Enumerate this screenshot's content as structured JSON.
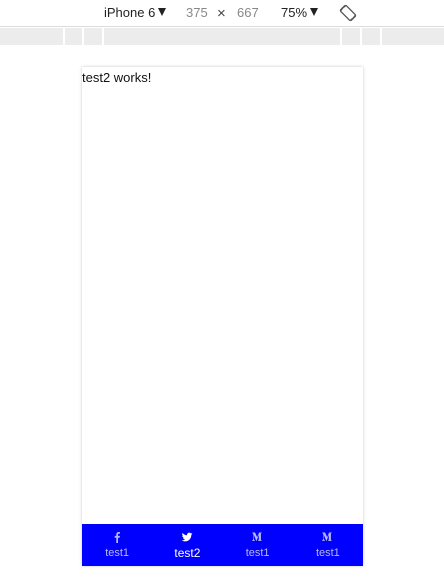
{
  "colors": {
    "tabbar_bg": "#0000ff",
    "tab_inactive": "#b8b8f5",
    "tab_active": "#ffffff"
  },
  "device_toolbar": {
    "device_name": "iPhone 6",
    "width": "375",
    "times": "×",
    "height": "667",
    "zoom": "75%",
    "rotate_icon": "rotate-icon"
  },
  "page": {
    "text": "test2 works!"
  },
  "tabbar": {
    "tabs": [
      {
        "label": "test1",
        "icon": "facebook-icon",
        "active": false
      },
      {
        "label": "test2",
        "icon": "twitter-icon",
        "active": true
      },
      {
        "label": "test1",
        "icon": "medium-icon",
        "active": false
      },
      {
        "label": "test1",
        "icon": "medium-icon",
        "active": false
      }
    ]
  }
}
